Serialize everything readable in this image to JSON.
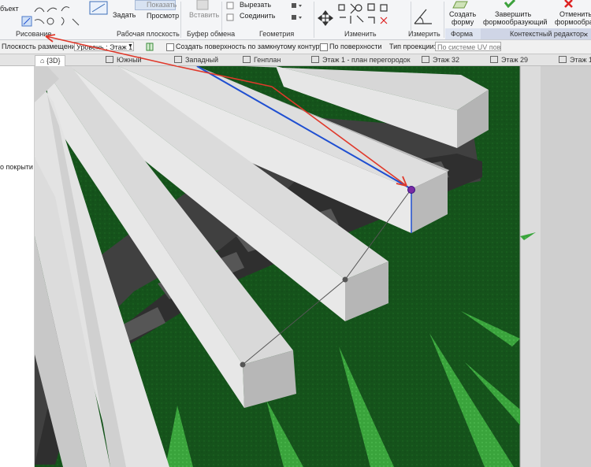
{
  "ribbon": {
    "left_cut_label": "бъект",
    "panels": {
      "draw": "Рисование",
      "workplane": "Рабочая плоскость",
      "clipboard": "Буфер обмена",
      "geometry": "Геометрия",
      "modify": "Изменить",
      "measure": "Измерить",
      "form": "Форма",
      "context_editor": "Контекстный редактор"
    },
    "buttons": {
      "set": "Задать",
      "show": "Показать",
      "viewer": "Просмотр",
      "paste": "Вставить",
      "cut": "Вырезать",
      "join": "Соединить",
      "create_form_1": "Создать",
      "create_form_2": "форму",
      "finish_form_1": "Завершить",
      "finish_form_2": "формообразующий",
      "cancel_form_1": "Отменить",
      "cancel_form_2": "формообразующ"
    }
  },
  "options_bar": {
    "placement_label": "Плоскость размещения:",
    "placement_value": "Уровень : Этаж 1",
    "closed_loop_label": "Создать поверхность по замкнутому контуру",
    "on_surface_label": "По поверхности",
    "projection_label": "Тип проекции:",
    "projection_value": "По системе UV пов"
  },
  "view_tabs": [
    {
      "label": "{3D}",
      "active": true
    },
    {
      "label": "Южный"
    },
    {
      "label": "Западный"
    },
    {
      "label": "Генплан"
    },
    {
      "label": "Этаж 1 - план перегородок"
    },
    {
      "label": "Этаж 32"
    },
    {
      "label": "Этаж 29"
    },
    {
      "label": "Этаж 15"
    }
  ],
  "left_panel": {
    "text": "о покрыти"
  },
  "colors": {
    "accent_blue": "#1f4fd1",
    "annotation_red": "#e0392b",
    "grass_dark": "#13521a",
    "grass_light": "#3fae3f",
    "context_tab": "#cfd5e6"
  }
}
